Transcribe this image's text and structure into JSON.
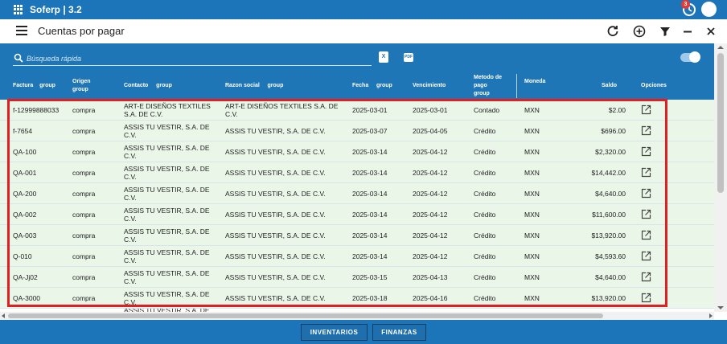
{
  "app": {
    "title": "Soferp | 3.2",
    "notifications": "3"
  },
  "toolbar": {
    "page_title": "Cuentas por pagar"
  },
  "search": {
    "placeholder": "Búsqueda rápida"
  },
  "exports": {
    "xls": "X",
    "pdf": "PDF"
  },
  "columns": [
    {
      "key": "factura",
      "label": "Factura",
      "group": "group"
    },
    {
      "key": "origen",
      "label": "Origen",
      "group": "group"
    },
    {
      "key": "contacto",
      "label": "Contacto",
      "group": "group"
    },
    {
      "key": "razon",
      "label": "Razon social",
      "group": "group"
    },
    {
      "key": "fecha",
      "label": "Fecha",
      "group": "group"
    },
    {
      "key": "vencimiento",
      "label": "Vencimiento",
      "group": ""
    },
    {
      "key": "metodo",
      "label": "Metodo de pago",
      "group": "group"
    },
    {
      "key": "moneda",
      "label": "Moneda",
      "group": ""
    },
    {
      "key": "saldo",
      "label": "Saldo",
      "group": ""
    },
    {
      "key": "opciones",
      "label": "Opciones",
      "group": ""
    }
  ],
  "rows": [
    {
      "factura": "f-12999888033",
      "origen": "compra",
      "contacto": "ART-E DISEÑOS TEXTILES S.A. DE C.V.",
      "razon": "ART-E DISEÑOS TEXTILES S.A. DE C.V.",
      "fecha": "2025-03-01",
      "vencimiento": "2025-03-01",
      "metodo": "Contado",
      "moneda": "MXN",
      "saldo": "$2.00"
    },
    {
      "factura": "f-7654",
      "origen": "compra",
      "contacto": "ASSIS TU VESTIR, S.A. DE C.V.",
      "razon": "ASSIS TU VESTIR, S.A. DE C.V.",
      "fecha": "2025-03-07",
      "vencimiento": "2025-04-05",
      "metodo": "Crédito",
      "moneda": "MXN",
      "saldo": "$696.00"
    },
    {
      "factura": "QA-100",
      "origen": "compra",
      "contacto": "ASSIS TU VESTIR, S.A. DE C.V.",
      "razon": "ASSIS TU VESTIR, S.A. DE C.V.",
      "fecha": "2025-03-14",
      "vencimiento": "2025-04-12",
      "metodo": "Crédito",
      "moneda": "MXN",
      "saldo": "$2,320.00"
    },
    {
      "factura": "QA-001",
      "origen": "compra",
      "contacto": "ASSIS TU VESTIR, S.A. DE C.V.",
      "razon": "ASSIS TU VESTIR, S.A. DE C.V.",
      "fecha": "2025-03-14",
      "vencimiento": "2025-04-12",
      "metodo": "Crédito",
      "moneda": "MXN",
      "saldo": "$14,442.00"
    },
    {
      "factura": "QA-200",
      "origen": "compra",
      "contacto": "ASSIS TU VESTIR, S.A. DE C.V.",
      "razon": "ASSIS TU VESTIR, S.A. DE C.V.",
      "fecha": "2025-03-14",
      "vencimiento": "2025-04-12",
      "metodo": "Crédito",
      "moneda": "MXN",
      "saldo": "$4,640.00"
    },
    {
      "factura": "QA-002",
      "origen": "compra",
      "contacto": "ASSIS TU VESTIR, S.A. DE C.V.",
      "razon": "ASSIS TU VESTIR, S.A. DE C.V.",
      "fecha": "2025-03-14",
      "vencimiento": "2025-04-12",
      "metodo": "Crédito",
      "moneda": "MXN",
      "saldo": "$11,600.00"
    },
    {
      "factura": "QA-003",
      "origen": "compra",
      "contacto": "ASSIS TU VESTIR, S.A. DE C.V.",
      "razon": "ASSIS TU VESTIR, S.A. DE C.V.",
      "fecha": "2025-03-14",
      "vencimiento": "2025-04-12",
      "metodo": "Crédito",
      "moneda": "MXN",
      "saldo": "$13,920.00"
    },
    {
      "factura": "Q-010",
      "origen": "compra",
      "contacto": "ASSIS TU VESTIR, S.A. DE C.V.",
      "razon": "ASSIS TU VESTIR, S.A. DE C.V.",
      "fecha": "2025-03-14",
      "vencimiento": "2025-04-12",
      "metodo": "Crédito",
      "moneda": "MXN",
      "saldo": "$4,593.60"
    },
    {
      "factura": "QA-Jj02",
      "origen": "compra",
      "contacto": "ASSIS TU VESTIR, S.A. DE C.V.",
      "razon": "ASSIS TU VESTIR, S.A. DE C.V.",
      "fecha": "2025-03-15",
      "vencimiento": "2025-04-13",
      "metodo": "Crédito",
      "moneda": "MXN",
      "saldo": "$4,640.00"
    },
    {
      "factura": "QA-3000",
      "origen": "compra",
      "contacto": "ASSIS TU VESTIR, S.A. DE C.V.",
      "razon": "ASSIS TU VESTIR, S.A. DE C.V.",
      "fecha": "2025-03-18",
      "vencimiento": "2025-04-16",
      "metodo": "Crédito",
      "moneda": "MXN",
      "saldo": "$13,920.00"
    }
  ],
  "partial_row": {
    "contacto": "ASSIS TU VESTIR, S.A. DE"
  },
  "bottom": {
    "inventarios": "INVENTARIOS",
    "finanzas": "FINANZAS"
  },
  "colors": {
    "primary": "#1c75b8",
    "highlight": "#e02020",
    "selected_row": "#eaf6e8"
  }
}
